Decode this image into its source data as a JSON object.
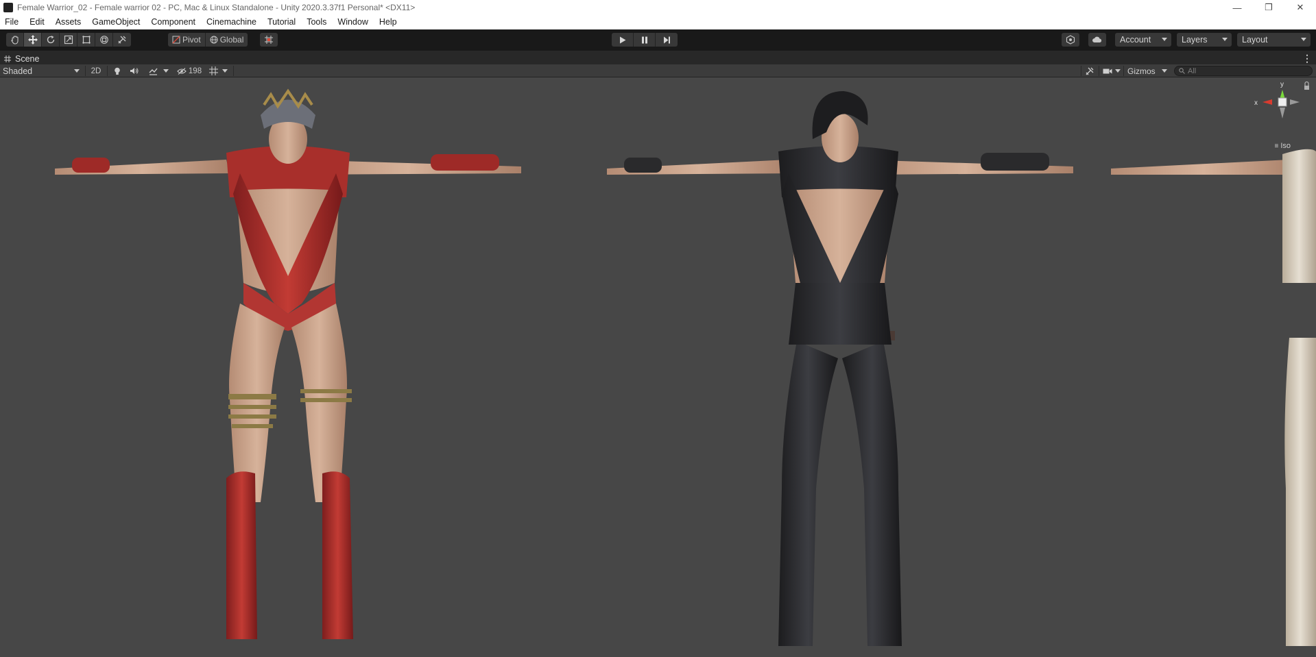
{
  "window": {
    "title": "Female Warrior_02 - Female warrior 02 - PC, Mac & Linux Standalone - Unity 2020.3.37f1 Personal* <DX11>",
    "minimize": "—",
    "restore": "❐",
    "close": "✕"
  },
  "menu": [
    "File",
    "Edit",
    "Assets",
    "GameObject",
    "Component",
    "Cinemachine",
    "Tutorial",
    "Tools",
    "Window",
    "Help"
  ],
  "toolbar": {
    "pivot_label": "Pivot",
    "global_label": "Global",
    "account_label": "Account",
    "layers_label": "Layers",
    "layout_label": "Layout"
  },
  "scene_tab": {
    "label": "Scene"
  },
  "scene_toolbar": {
    "draw_mode": "Shaded",
    "mode_2d": "2D",
    "hidden_count": "198",
    "gizmos_label": "Gizmos",
    "search_placeholder": "All"
  },
  "gizmo": {
    "y_label": "y",
    "x_label": "x",
    "projection": "Iso"
  },
  "colors": {
    "titlebar_bg": "#ffffff",
    "toolbar_bg": "#191919",
    "viewport_bg": "#474747",
    "axis_x": "#d93b2f",
    "axis_y": "#7ad93b"
  }
}
